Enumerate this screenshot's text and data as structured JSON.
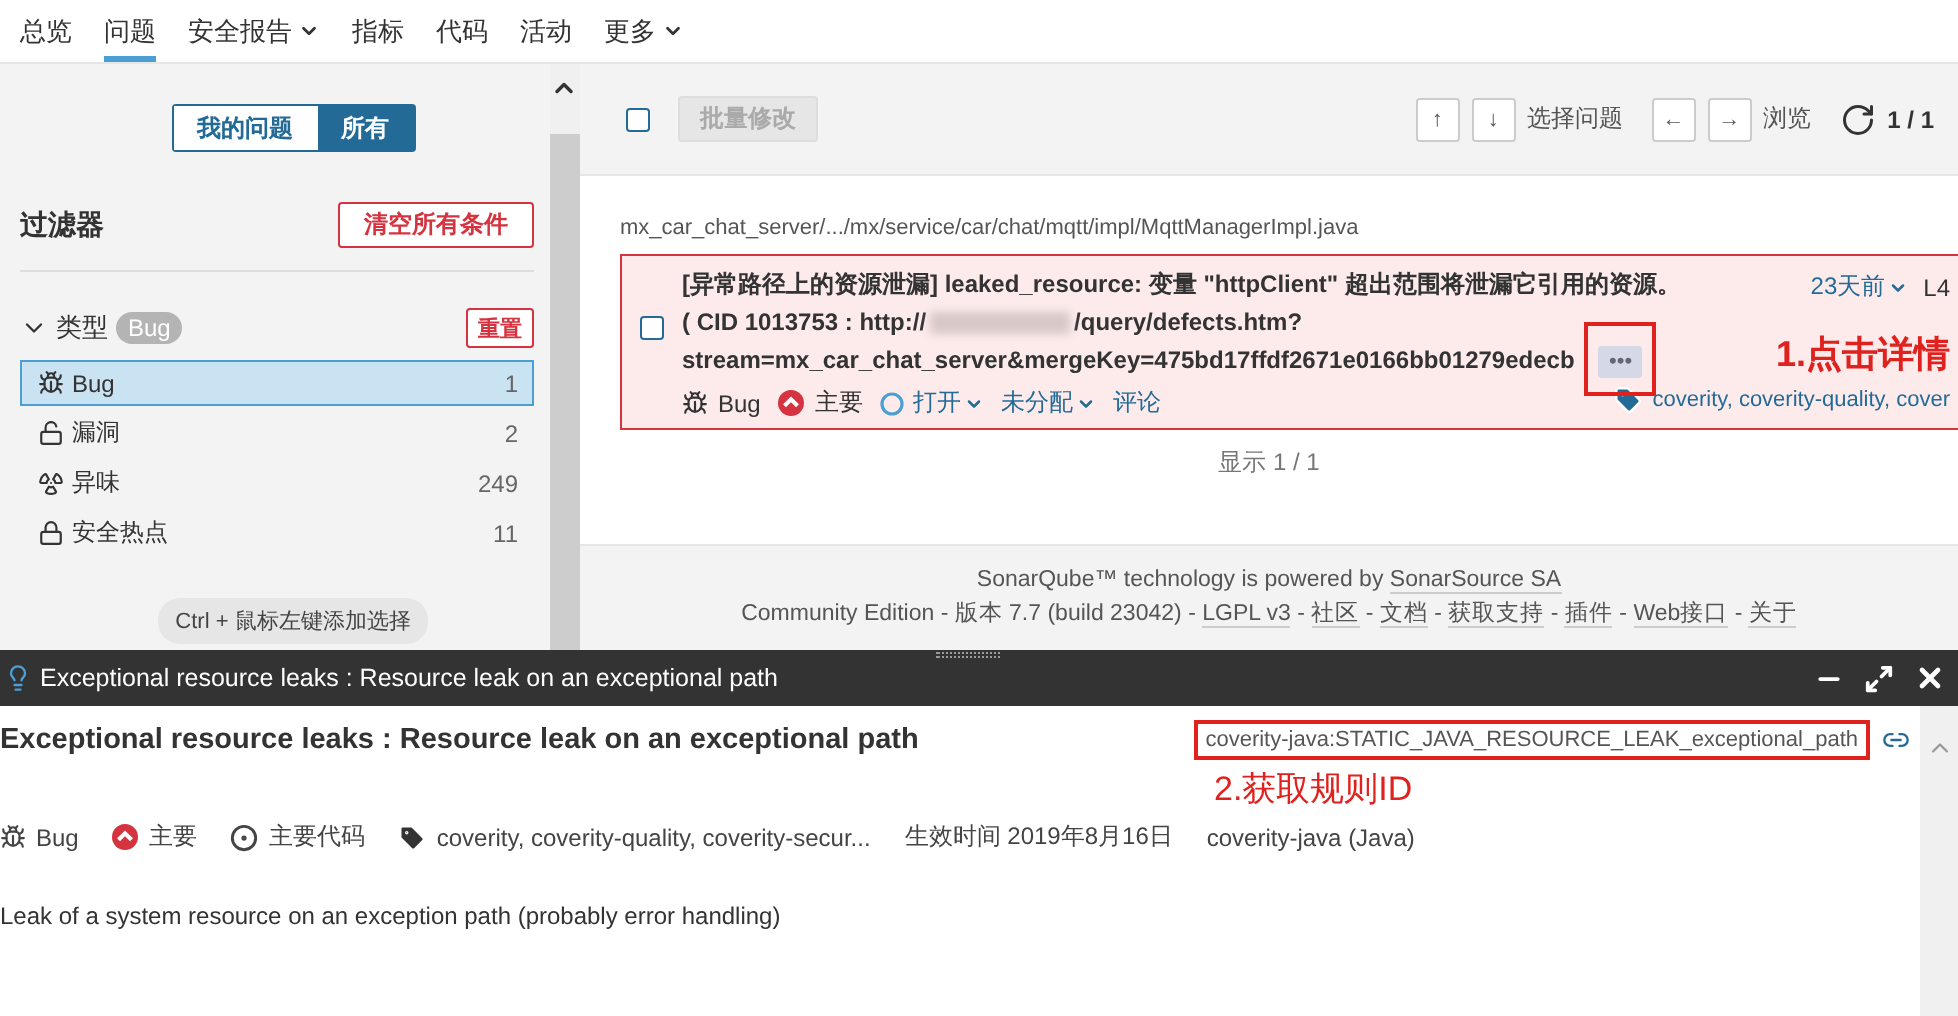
{
  "nav": [
    {
      "label": "总览",
      "selected": false,
      "dropdown": false
    },
    {
      "label": "问题",
      "selected": true,
      "dropdown": false
    },
    {
      "label": "安全报告",
      "selected": false,
      "dropdown": true
    },
    {
      "label": "指标",
      "selected": false,
      "dropdown": false
    },
    {
      "label": "代码",
      "selected": false,
      "dropdown": false
    },
    {
      "label": "活动",
      "selected": false,
      "dropdown": false
    },
    {
      "label": "更多",
      "selected": false,
      "dropdown": true
    }
  ],
  "sidebar": {
    "mode_toggle": [
      {
        "label": "我的问题",
        "selected": false
      },
      {
        "label": "所有",
        "selected": true
      }
    ],
    "filter_title": "过滤器",
    "clear_button": "清空所有条件",
    "facet": {
      "title": "类型",
      "expanded": true,
      "badge": "Bug",
      "reset": "重置",
      "items": [
        {
          "kind": "bug",
          "label": "Bug",
          "count": "1",
          "selected": true
        },
        {
          "kind": "vulnerability",
          "label": "漏洞",
          "count": "2",
          "selected": false
        },
        {
          "kind": "smell",
          "label": "异味",
          "count": "249",
          "selected": false
        },
        {
          "kind": "hotspot",
          "label": "安全热点",
          "count": "11",
          "selected": false
        }
      ]
    },
    "hint": "Ctrl + 鼠标左键添加选择"
  },
  "toolbar": {
    "select_all_checked": false,
    "issue_keys": [
      "↑",
      "↓"
    ],
    "browse_keys": [
      "←",
      "→"
    ],
    "bulk_button": "批量修改",
    "select_label": "选择问题",
    "browse_label": "浏览",
    "page_count": "1 / 1"
  },
  "issues": {
    "path": "mx_car_chat_server/.../mx/service/car/chat/mqtt/impl/MqttManagerImpl.java",
    "items": [
      {
        "checked": false,
        "message": "[异常路径上的资源泄漏] leaked_resource: 变量 \"httpClient\" 超出范围将泄漏它引用的资源。",
        "cid_text": "( CID 1013753 : http://",
        "url_text": "/query/defects.htm?",
        "stream_text": "stream=mx_car_chat_server&mergeKey=475bd17ffdf2671e0166bb01279edecb",
        "more_button": "•••",
        "type": "Bug",
        "severity": "主要",
        "status": "打开",
        "assignee": "未分配",
        "comment": "评论",
        "age": "23天前",
        "line": "L4",
        "tags": "coverity, coverity-quality, cover"
      }
    ],
    "shown": "显示 1 / 1"
  },
  "footer": {
    "line1": "SonarQube™ technology is powered by",
    "line1_link": "SonarSource SA",
    "line2": "Community Edition - 版本 7.7 (build 23042)",
    "separator": "-",
    "links": [
      "LGPL v3",
      "社区",
      "文档",
      "获取支持",
      "插件",
      "Web接口",
      "关于"
    ]
  },
  "rule_panel": {
    "title": "Exceptional resource leaks : Resource leak on an exceptional path",
    "heading": "Exceptional resource leaks : Resource leak on an exceptional path",
    "rule_key": "coverity-java:STATIC_JAVA_RESOURCE_LEAK_exceptional_path",
    "type": "Bug",
    "severity": "主要",
    "profile": "主要代码",
    "tags": "coverity, coverity-quality, coverity-secur...",
    "date": "生效时间 2019年8月16日",
    "repository": "coverity-java (Java)",
    "description": "Leak of a system resource on an exception path (probably error handling)"
  },
  "annotations": [
    {
      "text": "1.点击详情"
    },
    {
      "text": "2.获取规则ID"
    }
  ]
}
